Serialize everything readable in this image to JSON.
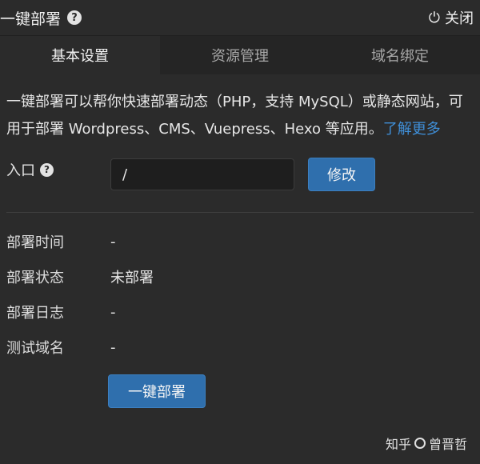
{
  "header": {
    "title": "一键部署",
    "help_icon": "?",
    "close_label": "关闭",
    "close_icon": "⏻"
  },
  "tabs": [
    {
      "label": "基本设置",
      "active": true
    },
    {
      "label": "资源管理",
      "active": false
    },
    {
      "label": "域名绑定",
      "active": false
    }
  ],
  "description": {
    "text": "一键部署可以帮你快速部署动态（PHP，支持 MySQL）或静态网站，可用于部署 Wordpress、CMS、Vuepress、Hexo 等应用。",
    "link": "了解更多"
  },
  "entry": {
    "label": "入口",
    "help_icon": "?",
    "value": "/",
    "button": "修改"
  },
  "info": [
    {
      "label": "部署时间",
      "value": "-"
    },
    {
      "label": "部署状态",
      "value": "未部署"
    },
    {
      "label": "部署日志",
      "value": "-"
    },
    {
      "label": "测试域名",
      "value": "-"
    }
  ],
  "deploy_button": "一键部署",
  "watermark": {
    "site": "知乎",
    "author": "曾晋哲"
  }
}
